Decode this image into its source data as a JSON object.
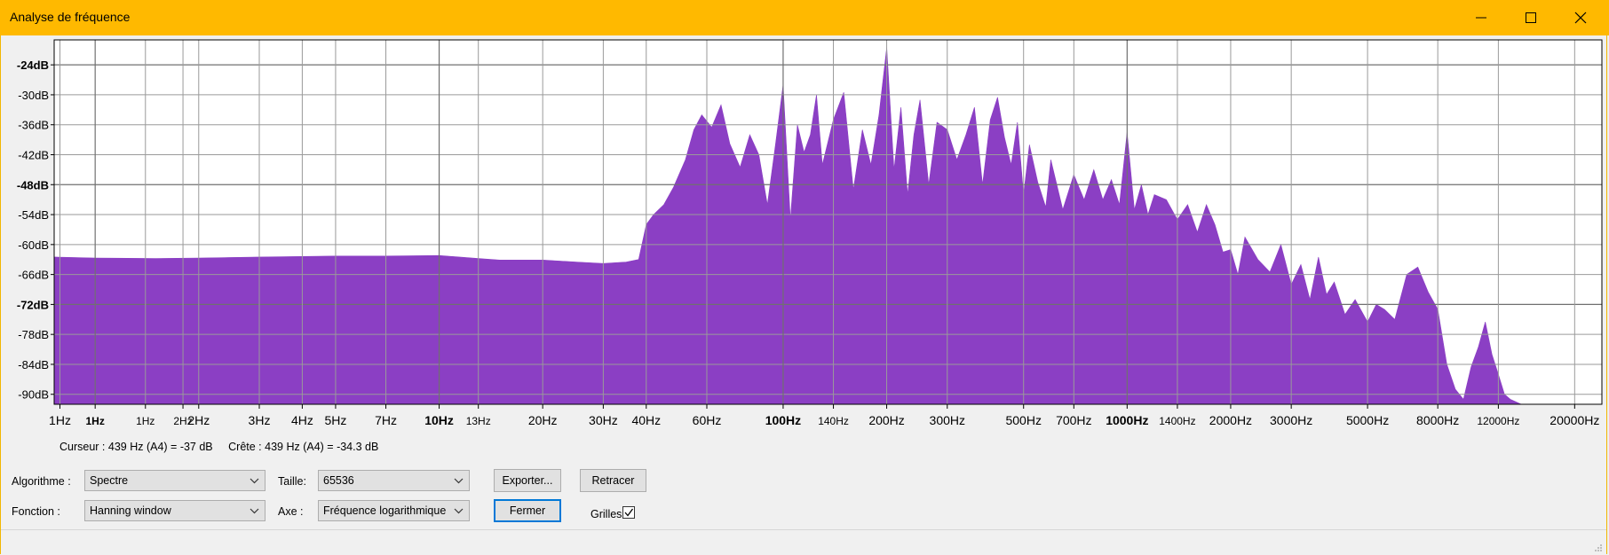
{
  "window": {
    "title": "Analyse de fréquence",
    "controls": [
      "minimize-icon",
      "maximize-icon",
      "close-icon"
    ]
  },
  "chart_data": {
    "type": "area",
    "x_scale": "log",
    "grid": true,
    "fill_color": "#8b3fc4",
    "y_ticks": [
      "-24dB",
      "-30dB",
      "-36dB",
      "-42dB",
      "-48dB",
      "-54dB",
      "-60dB",
      "-66dB",
      "-72dB",
      "-78dB",
      "-84dB",
      "-90dB"
    ],
    "y_tick_values": [
      -24,
      -30,
      -36,
      -42,
      -48,
      -54,
      -60,
      -66,
      -72,
      -78,
      -84,
      -90
    ],
    "y_major_ticks": [
      "-24dB",
      "-48dB",
      "-72dB"
    ],
    "ylim": [
      -92,
      -19
    ],
    "x_ticks": [
      "1Hz",
      "1Hz",
      "1Hz",
      "2Hz",
      "2Hz",
      "3Hz",
      "4Hz",
      "5Hz",
      "7Hz",
      "10Hz",
      "13Hz",
      "20Hz",
      "30Hz",
      "40Hz",
      "60Hz",
      "100Hz",
      "140Hz",
      "200Hz",
      "300Hz",
      "500Hz",
      "700Hz",
      "1000Hz",
      "1400Hz",
      "2000Hz",
      "3000Hz",
      "5000Hz",
      "8000Hz",
      "12000Hz",
      "20000Hz"
    ],
    "x_tick_values": [
      0.79,
      1,
      1.4,
      1.8,
      2,
      3,
      4,
      5,
      7,
      10,
      13,
      20,
      30,
      40,
      60,
      100,
      140,
      200,
      300,
      500,
      700,
      1000,
      1400,
      2000,
      3000,
      5000,
      8000,
      12000,
      20000
    ],
    "x_major_ticks": [
      "1Hz",
      "10Hz",
      "100Hz",
      "1000Hz"
    ],
    "xlim": [
      0.76,
      24000
    ],
    "frequencies": [
      0.76,
      1,
      1.5,
      2,
      3,
      5,
      7,
      10,
      13,
      15,
      20,
      25,
      30,
      35,
      38,
      40,
      42,
      45,
      48,
      52,
      55,
      58,
      62,
      66,
      70,
      75,
      80,
      85,
      90,
      95,
      100,
      105,
      110,
      115,
      120,
      125,
      130,
      140,
      150,
      160,
      170,
      180,
      190,
      200,
      210,
      220,
      230,
      240,
      250,
      265,
      280,
      300,
      320,
      340,
      360,
      380,
      400,
      420,
      440,
      460,
      480,
      500,
      520,
      550,
      580,
      600,
      650,
      700,
      750,
      800,
      850,
      900,
      950,
      1000,
      1050,
      1100,
      1150,
      1200,
      1300,
      1400,
      1500,
      1600,
      1700,
      1800,
      1900,
      2000,
      2100,
      2200,
      2400,
      2600,
      2800,
      3000,
      3200,
      3400,
      3600,
      3800,
      4000,
      4300,
      4600,
      5000,
      5300,
      5600,
      6000,
      6500,
      7000,
      7500,
      8000,
      8500,
      9000,
      9500,
      10000,
      10500,
      11000,
      11500,
      12000,
      12500,
      13000,
      14000,
      16000,
      24000
    ],
    "levels_db": [
      -62.5,
      -62.7,
      -62.8,
      -62.7,
      -62.5,
      -62.3,
      -62.3,
      -62.2,
      -62.8,
      -63.1,
      -63.1,
      -63.5,
      -63.8,
      -63.5,
      -63,
      -56,
      -54,
      -52,
      -48.5,
      -43,
      -37,
      -34,
      -36.5,
      -32,
      -39.8,
      -44.5,
      -38,
      -42,
      -52,
      -40,
      -28,
      -55,
      -36,
      -41.5,
      -38,
      -30,
      -44,
      -35,
      -29.5,
      -49,
      -37,
      -44,
      -34,
      -20.5,
      -45,
      -32.5,
      -50,
      -38,
      -31,
      -48,
      -35.5,
      -37,
      -43,
      -38,
      -32.5,
      -48,
      -35,
      -30.5,
      -38.5,
      -44,
      -35.5,
      -50,
      -40,
      -47.5,
      -52.5,
      -43,
      -53,
      -46,
      -51,
      -45,
      -51,
      -47,
      -52,
      -37.5,
      -53,
      -48,
      -54,
      -50,
      -51,
      -55,
      -52,
      -57.5,
      -52,
      -56,
      -61.5,
      -61,
      -66,
      -58.5,
      -63,
      -65.5,
      -60,
      -68,
      -64,
      -71,
      -62.5,
      -70,
      -67.5,
      -74,
      -71,
      -75.5,
      -72,
      -73,
      -75,
      -66,
      -64.5,
      -69.5,
      -73,
      -84,
      -89,
      -91,
      -84.5,
      -80.5,
      -75.5,
      -82,
      -86,
      -90,
      -91,
      -92,
      -92,
      -92
    ],
    "series": [
      {
        "name": "",
        "color": "#8b3fc4"
      }
    ]
  },
  "readout": {
    "cursor": "Curseur : 439 Hz (A4) = -37 dB",
    "peak": "Crête : 439 Hz (A4) = -34.3 dB"
  },
  "controls": {
    "algorithm_label": "Algorithme :",
    "algorithm_value": "Spectre",
    "size_label": "Taille:",
    "size_value": "65536",
    "function_label": "Fonction :",
    "function_value": "Hanning window",
    "axis_label": "Axe :",
    "axis_value": "Fréquence logarithmique",
    "export_button": "Exporter...",
    "replot_button": "Retracer",
    "close_button": "Fermer",
    "grids_label": "Grilles",
    "grids_checked": true
  }
}
